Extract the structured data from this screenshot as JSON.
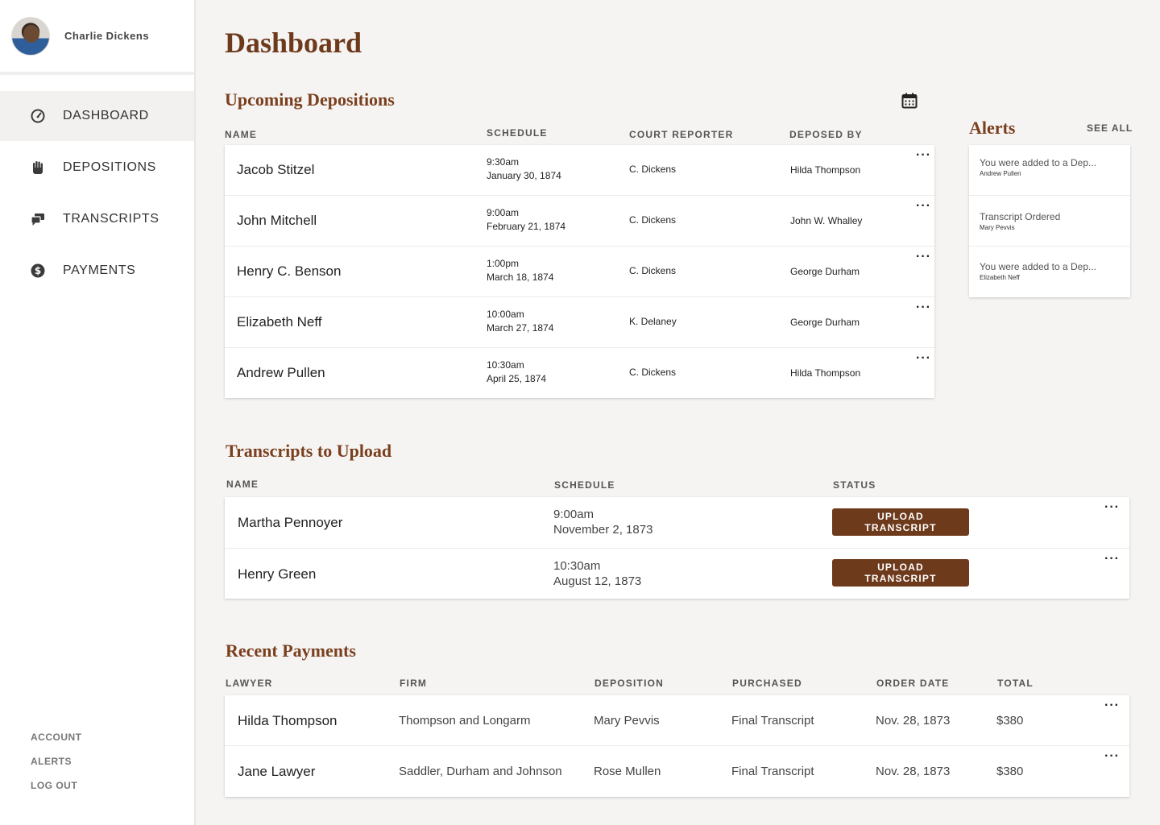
{
  "user": {
    "name": "Charlie Dickens"
  },
  "nav": [
    {
      "label": "DASHBOARD",
      "icon": "gauge-icon"
    },
    {
      "label": "DEPOSITIONS",
      "icon": "hand-icon"
    },
    {
      "label": "TRANSCRIPTS",
      "icon": "chat-icon"
    },
    {
      "label": "PAYMENTS",
      "icon": "dollar-icon"
    }
  ],
  "footer_links": [
    "ACCOUNT",
    "ALERTS",
    "LOG OUT"
  ],
  "page_title": "Dashboard",
  "depositions": {
    "title": "Upcoming Depositions",
    "headers": [
      "NAME",
      "SCHEDULE",
      "COURT REPORTER",
      "DEPOSED BY"
    ],
    "rows": [
      {
        "name": "Jacob Stitzel",
        "time": "9:30am",
        "date": "January 30, 1874",
        "reporter": "C. Dickens",
        "deposed_by": "Hilda Thompson"
      },
      {
        "name": "John Mitchell",
        "time": "9:00am",
        "date": "February 21, 1874",
        "reporter": "C. Dickens",
        "deposed_by": "John W. Whalley"
      },
      {
        "name": "Henry C. Benson",
        "time": "1:00pm",
        "date": "March 18, 1874",
        "reporter": "C. Dickens",
        "deposed_by": "George Durham"
      },
      {
        "name": "Elizabeth Neff",
        "time": "10:00am",
        "date": "March 27, 1874",
        "reporter": "K. Delaney",
        "deposed_by": "George Durham"
      },
      {
        "name": "Andrew Pullen",
        "time": "10:30am",
        "date": "April 25, 1874",
        "reporter": "C. Dickens",
        "deposed_by": "Hilda Thompson"
      }
    ]
  },
  "alerts": {
    "title": "Alerts",
    "see_all": "SEE ALL",
    "items": [
      {
        "text": "You were added to a Dep...",
        "sub": "Andrew Pullen"
      },
      {
        "text": "Transcript Ordered",
        "sub": "Mary Pevvis"
      },
      {
        "text": "You were added to a Dep...",
        "sub": "Elizabeth Neff"
      }
    ]
  },
  "transcripts": {
    "title": "Transcripts to Upload",
    "headers": [
      "NAME",
      "SCHEDULE",
      "STATUS"
    ],
    "button_label": "UPLOAD TRANSCRIPT",
    "rows": [
      {
        "name": "Martha Pennoyer",
        "time": "9:00am",
        "date": "November 2, 1873"
      },
      {
        "name": "Henry Green",
        "time": "10:30am",
        "date": "August 12, 1873"
      }
    ]
  },
  "payments": {
    "title": "Recent Payments",
    "headers": [
      "LAWYER",
      "FIRM",
      "DEPOSITION",
      "PURCHASED",
      "ORDER DATE",
      "TOTAL"
    ],
    "rows": [
      {
        "lawyer": "Hilda Thompson",
        "firm": "Thompson and Longarm",
        "deposition": "Mary Pevvis",
        "purchased": "Final Transcript",
        "order_date": "Nov. 28, 1873",
        "total": "$380"
      },
      {
        "lawyer": "Jane Lawyer",
        "firm": "Saddler, Durham and Johnson",
        "deposition": "Rose Mullen",
        "purchased": "Final Transcript",
        "order_date": "Nov. 28, 1873",
        "total": "$380"
      }
    ]
  },
  "colors": {
    "accent": "#6e3a1c",
    "background": "#f5f4f2"
  }
}
